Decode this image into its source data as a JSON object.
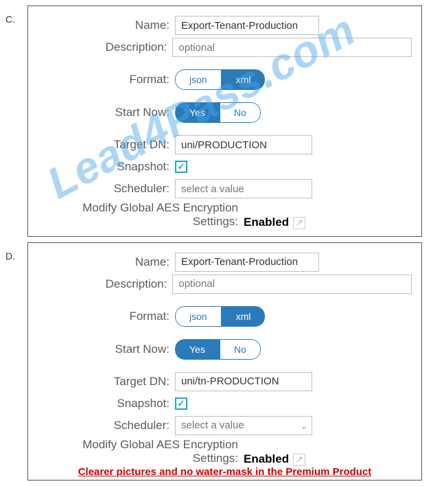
{
  "optionC": {
    "letter": "C.",
    "name_label": "Name:",
    "name_value": "Export-Tenant-Production",
    "desc_label": "Description:",
    "desc_placeholder": "optional",
    "format_label": "Format:",
    "format_json": "json",
    "format_xml": "xml",
    "startnow_label": "Start Now:",
    "startnow_yes": "Yes",
    "startnow_no": "No",
    "targetdn_label": "Target DN:",
    "targetdn_value": "uni/PRODUCTION",
    "snapshot_label": "Snapshot:",
    "snapshot_check": "✓",
    "scheduler_label": "Scheduler:",
    "scheduler_placeholder": "select a value",
    "aes_label_line": "Modify Global AES Encryption Settings:",
    "aes_value": "Enabled"
  },
  "optionD": {
    "letter": "D.",
    "name_label": "Name:",
    "name_value": "Export-Tenant-Production",
    "desc_label": "Description:",
    "desc_placeholder": "optional",
    "format_label": "Format:",
    "format_json": "json",
    "format_xml": "xml",
    "startnow_label": "Start Now:",
    "startnow_yes": "Yes",
    "startnow_no": "No",
    "targetdn_label": "Target DN:",
    "targetdn_value": "uni/tn-PRODUCTION",
    "snapshot_label": "Snapshot:",
    "snapshot_check": "✓",
    "scheduler_label": "Scheduler:",
    "scheduler_placeholder": "select a value",
    "aes_label_line": "Modify Global AES Encryption Settings:",
    "aes_value": "Enabled"
  },
  "watermark": "Lead4Pass.com",
  "promo": "Clearer pictures and no water-mask in the Premium Product"
}
